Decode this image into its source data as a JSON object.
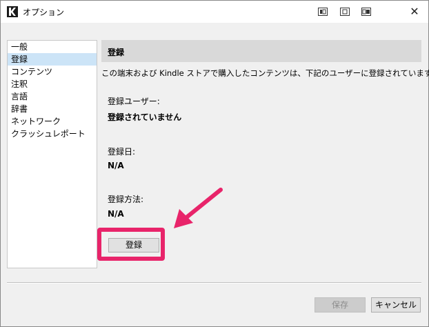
{
  "window": {
    "title": "オプション",
    "close_glyph": "✕"
  },
  "sidebar": {
    "items": [
      {
        "label": "一般"
      },
      {
        "label": "登録"
      },
      {
        "label": "コンテンツ"
      },
      {
        "label": "注釈"
      },
      {
        "label": "言語"
      },
      {
        "label": "辞書"
      },
      {
        "label": "ネットワーク"
      },
      {
        "label": "クラッシュレポート"
      }
    ],
    "selected_index": 1
  },
  "content": {
    "header": "登録",
    "description": "この端末および Kindle ストアで購入したコンテンツは、下記のユーザーに登録されています。",
    "user_label": "登録ユーザー:",
    "user_value": "登録されていません",
    "date_label": "登録日:",
    "date_value": "N/A",
    "method_label": "登録方法:",
    "method_value": "N/A",
    "register_button": "登録"
  },
  "footer": {
    "save_button": "保存",
    "cancel_button": "キャンセル"
  },
  "colors": {
    "highlight": "#e8246a",
    "selected_item": "#cce4f7",
    "header_bg": "#d9d9d9"
  },
  "icons": {
    "app": "kindle-icon",
    "title_buttons": [
      "compact-view-icon",
      "normal-view-icon",
      "wide-view-icon"
    ],
    "close": "close-icon"
  }
}
